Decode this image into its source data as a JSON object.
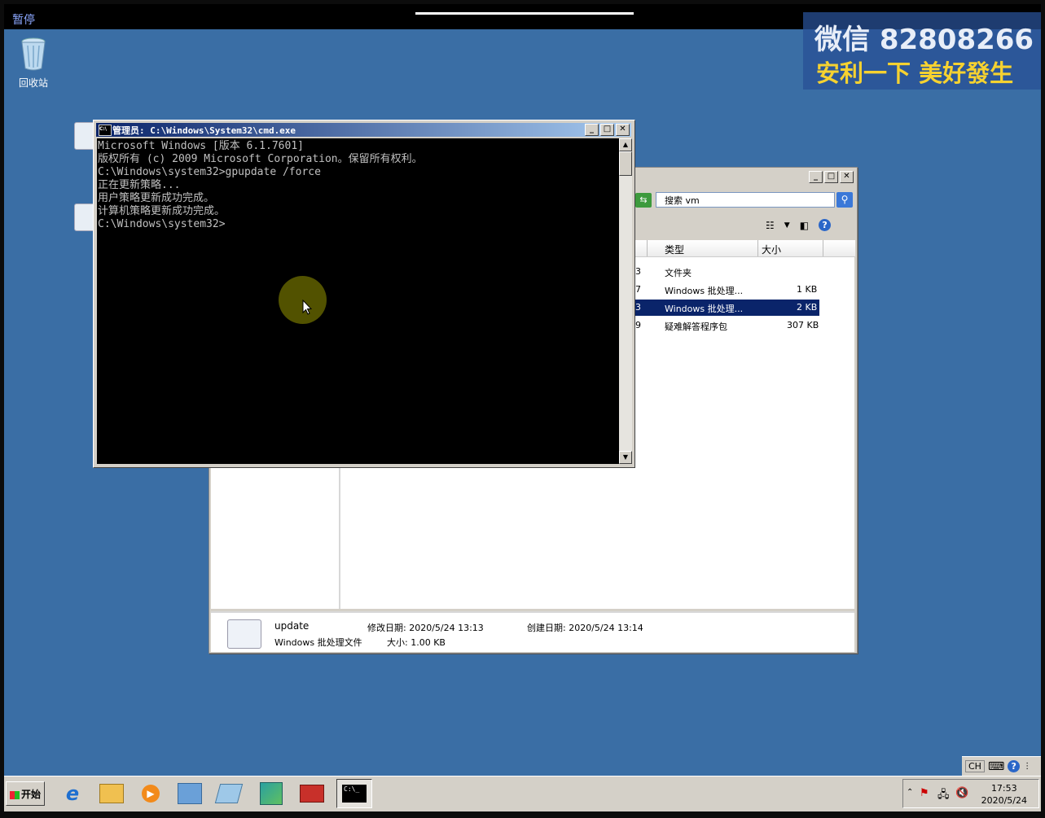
{
  "topbar": {
    "pause_label": "暂停"
  },
  "watermark": {
    "line1": "微信 82808266",
    "line2": "安利一下 美好發生"
  },
  "desktop": {
    "recycle_bin_label": "回收站"
  },
  "cmd_window": {
    "title": "管理员: C:\\Windows\\System32\\cmd.exe",
    "lines": [
      "Microsoft Windows [版本 6.1.7601]",
      "版权所有 (c) 2009 Microsoft Corporation。保留所有权利。",
      "",
      "C:\\Windows\\system32>gpupdate /force",
      "正在更新策略...",
      "",
      "用户策略更新成功完成。",
      "计算机策略更新成功完成。",
      "",
      "",
      "C:\\Windows\\system32>"
    ]
  },
  "explorer_window": {
    "search_placeholder": "搜索 vm",
    "columns": {
      "type": "类型",
      "size": "大小"
    },
    "rows": [
      {
        "date_suffix": "3",
        "type": "文件夹",
        "size": "",
        "selected": false
      },
      {
        "date_suffix": "7",
        "type": "Windows 批处理...",
        "size": "1 KB",
        "selected": false
      },
      {
        "date_suffix": "3",
        "type": "Windows 批处理...",
        "size": "2 KB",
        "selected": true
      },
      {
        "date_suffix": "9",
        "type": "疑难解答程序包",
        "size": "307 KB",
        "selected": false
      }
    ],
    "details": {
      "name": "update",
      "modified_label": "修改日期: 2020/5/24 13:13",
      "created_label": "创建日期: 2020/5/24 13:14",
      "type": "Windows 批处理文件",
      "size_label": "大小: 1.00 KB"
    }
  },
  "taskbar": {
    "start_label": "开始",
    "input_lang": "CH",
    "clock_time": "17:53",
    "clock_date": "2020/5/24",
    "cmd_icon_text": "C:\\_"
  }
}
